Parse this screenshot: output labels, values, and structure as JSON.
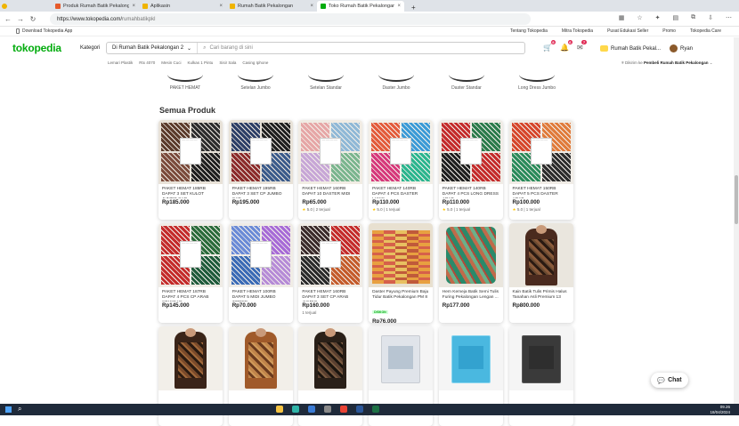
{
  "tabs": [
    {
      "title": "Produk Rumah Batik Pekalongan",
      "color": "#e65a2a"
    },
    {
      "title": "Aplikasin",
      "color": "#f0b400"
    },
    {
      "title": "Rumah Batik Pekalongan",
      "color": "#f0b400"
    },
    {
      "title": "Toko Rumah Batik Pekalongan 2",
      "color": "#03ac0e"
    }
  ],
  "url": {
    "host": "https://www.tokopedia.com/",
    "path": "rumahbatikpkl"
  },
  "bookmarks": {
    "app": "Download Tokopedia App",
    "links": [
      "Tentang Tokopedia",
      "Mitra Tokopedia",
      "Pusat Edukasi Seller",
      "Promo",
      "Tokopedia Care"
    ]
  },
  "header": {
    "logo": "tokopedia",
    "kategori": "Kategori",
    "store": "Di Rumah Batik Pekalongan 2",
    "search_placeholder": "Cari barang di sini",
    "shop": "Rumah Batik Pekal...",
    "user": "Ryan",
    "badges": [
      "9",
      "6",
      "7"
    ]
  },
  "subnav": {
    "links": [
      "Lemari Plastik",
      "Rtx 4070",
      "Mesin Cuci",
      "Kulkas 1 Pintu",
      "Sisir Sala",
      "Casing Iphone"
    ],
    "ship_prefix": "Dikirim ke",
    "ship_to": "Pembeli Rumah Batik Pekalongan"
  },
  "etalase": [
    "PAKET HEMAT",
    "Setelan Jumbo",
    "Setelan Standar",
    "Daster Jumbo",
    "Daster Standar",
    "Long Dress Jumbo"
  ],
  "section_title": "Semua Produk",
  "products": [
    {
      "name": "PAKET HEMAT 185RB DAPAT 3 SET KULOT JUMBO CAP",
      "price": "Rp185.000",
      "meta": "",
      "rating": "",
      "img": "set-brown"
    },
    {
      "name": "PAKET HEMAT 195RB DAPAT 3 SET CP JUMBO CAP",
      "price": "Rp195.000",
      "meta": "",
      "rating": "",
      "img": "set-blue"
    },
    {
      "name": "PAKET HEMAT 160RB DAPAT 10 DASTER MIDI",
      "price": "Rp65.000",
      "meta": "5.0 | 2 terjual",
      "rating": "★",
      "img": "daster-pastel"
    },
    {
      "name": "PAKET HEMAT 140RB DAPAT 4 PCS DASTER LUKIS ...",
      "price": "Rp110.000",
      "meta": "5.0 | 1 terjual",
      "rating": "★",
      "img": "daster-color"
    },
    {
      "name": "PAKET HEMAT 140RB DAPAT 4 PCS LONG DRESS ARAB",
      "price": "Rp110.000",
      "meta": "5.0 | 1 terjual",
      "rating": "★",
      "img": "dress-red"
    },
    {
      "name": "PAKET HEMAT 150RB DAPAT 5 PCS DASTER ARAB ...",
      "price": "Rp100.000",
      "meta": "5.0 | 1 terjual",
      "rating": "★",
      "img": "daster-red"
    },
    {
      "name": "PAKET HEMAT 187RB DAPAT 4 PCS CP ARAB STANDAR",
      "price": "Rp145.000",
      "meta": "",
      "rating": "",
      "img": "set-red"
    },
    {
      "name": "PAKET HEMAT 100RB DAPAT 5 MIDI JUMBO ZIPPER",
      "price": "Rp70.000",
      "meta": "",
      "rating": "",
      "img": "midi-blue"
    },
    {
      "name": "PAKET HEMAT 160RB DAPAT 3 SET CP ARAB JUMBO",
      "price": "Rp160.000",
      "meta": "1 terjual",
      "rating": "",
      "img": "set-mix"
    },
    {
      "name": "Daster Payung Premium Baju Tidur Batik Pekalongan PM 8",
      "price": "Rp76.000",
      "meta": "1 terjual",
      "rating": "",
      "tag": "DISKON",
      "img": "payung"
    },
    {
      "name": "Hem Kemeja Batik Semi Tulis Furing Pekalongan Lengan ...",
      "price": "Rp177.000",
      "meta": "",
      "rating": "",
      "img": "kemeja"
    },
    {
      "name": "Kain Batik Tulis Primis Halus Tanahan Asli Premium 13",
      "price": "Rp800.000",
      "meta": "",
      "rating": "",
      "img": "kain"
    },
    {
      "name": "",
      "price": "",
      "meta": "",
      "rating": "",
      "img": "kain-brown"
    },
    {
      "name": "",
      "price": "",
      "meta": "",
      "rating": "",
      "img": "kain-orange"
    },
    {
      "name": "",
      "price": "",
      "meta": "",
      "rating": "",
      "img": "kain-dark"
    },
    {
      "name": "",
      "price": "",
      "meta": "",
      "rating": "",
      "img": "plastik"
    },
    {
      "name": "",
      "price": "",
      "meta": "",
      "rating": "",
      "img": "plastik-blue"
    },
    {
      "name": "",
      "price": "",
      "meta": "",
      "rating": "",
      "img": "plastik-grey"
    }
  ],
  "chat_label": "Chat",
  "tray": {
    "time": "09.26",
    "date": "18/04/2024"
  }
}
